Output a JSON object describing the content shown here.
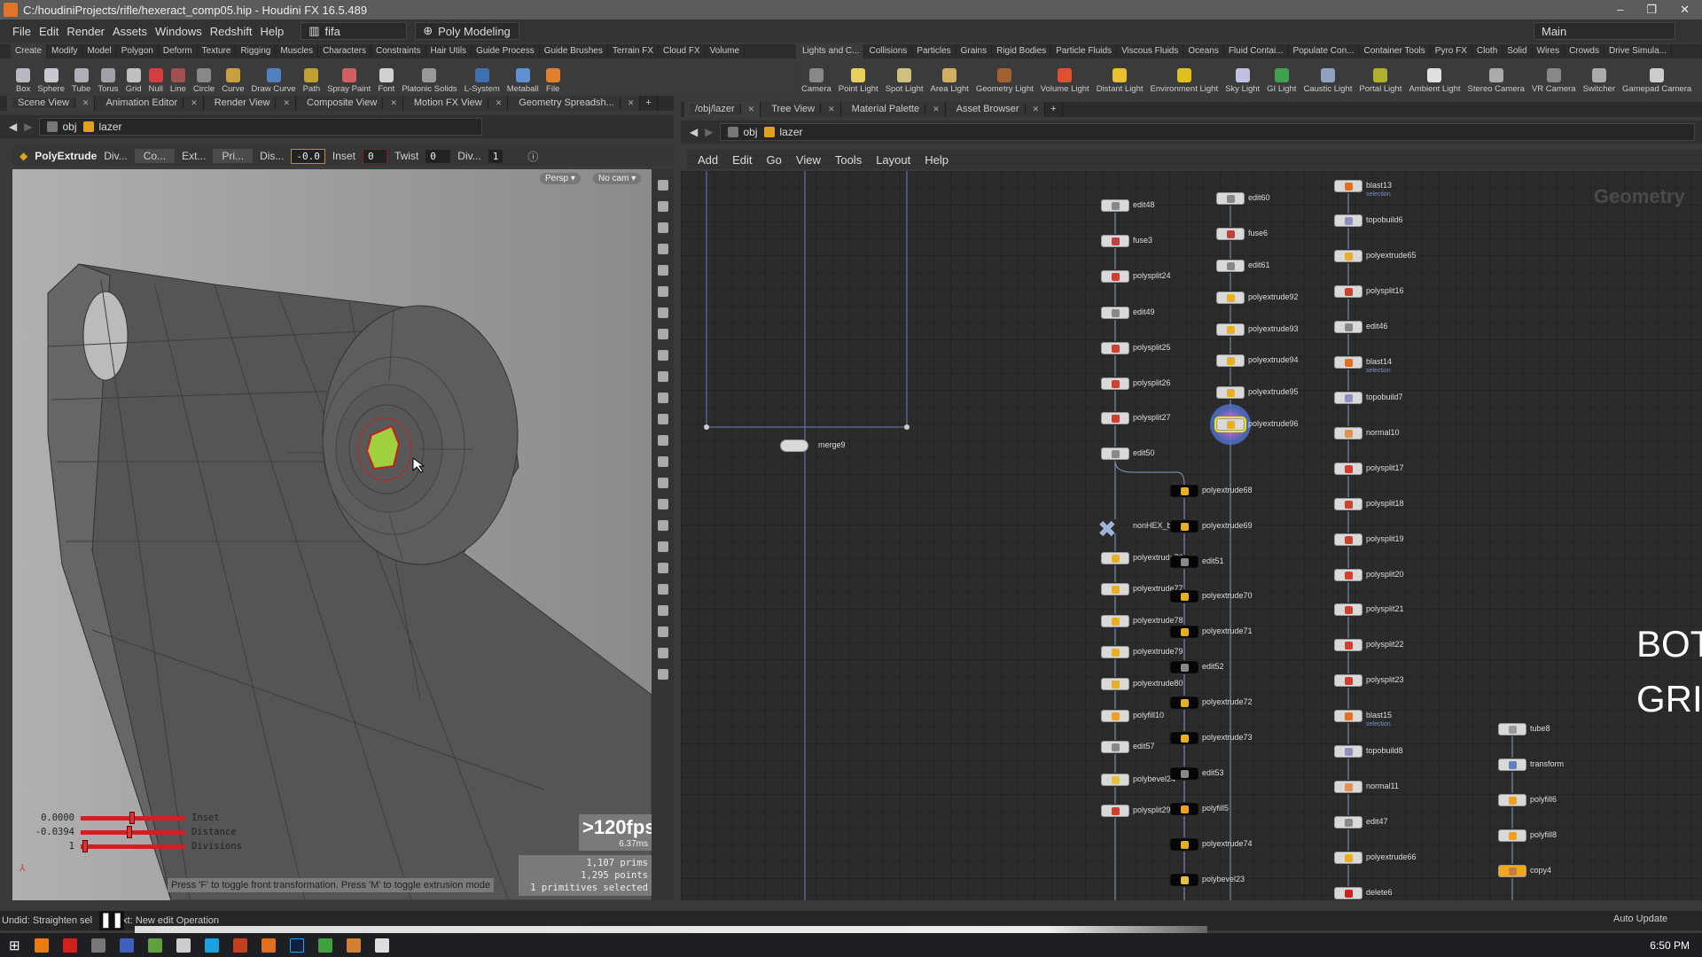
{
  "window": {
    "title": "C:/houdiniProjects/rifle/hexeract_comp05.hip - Houdini FX 16.5.489",
    "controls": [
      "–",
      "❐",
      "✕"
    ]
  },
  "menu": [
    "File",
    "Edit",
    "Render",
    "Assets",
    "Windows",
    "Redshift",
    "Help"
  ],
  "desktop": {
    "name": "fifa",
    "shelf_set": "Poly Modeling",
    "main": "Main"
  },
  "shelf_left": {
    "tabs": [
      "Create",
      "Modify",
      "Model",
      "Polygon",
      "Deform",
      "Texture",
      "Rigging",
      "Muscles",
      "Characters",
      "Constraints",
      "Hair Utils",
      "Guide Process",
      "Guide Brushes",
      "Terrain FX",
      "Cloud FX",
      "Volume"
    ],
    "tools": [
      {
        "label": "Box",
        "color": "#b8b8c0"
      },
      {
        "label": "Sphere",
        "color": "#c8c8d0"
      },
      {
        "label": "Tube",
        "color": "#b0b0b8"
      },
      {
        "label": "Torus",
        "color": "#a0a0a8"
      },
      {
        "label": "Grid",
        "color": "#c0c0c0"
      },
      {
        "label": "Null",
        "color": "#d04040"
      },
      {
        "label": "Line",
        "color": "#a05050"
      },
      {
        "label": "Circle",
        "color": "#888"
      },
      {
        "label": "Curve",
        "color": "#c8a040"
      },
      {
        "label": "Draw Curve",
        "color": "#5080c0"
      },
      {
        "label": "Path",
        "color": "#c0a030"
      },
      {
        "label": "Spray Paint",
        "color": "#d06060"
      },
      {
        "label": "Font",
        "color": "#d0d0d0"
      },
      {
        "label": "Platonic Solids",
        "color": "#999"
      },
      {
        "label": "L-System",
        "color": "#4070b0"
      },
      {
        "label": "Metaball",
        "color": "#6090d0"
      },
      {
        "label": "File",
        "color": "#e08030"
      }
    ]
  },
  "shelf_right": {
    "tabs": [
      "Lights and C...",
      "Collisions",
      "Particles",
      "Grains",
      "Rigid Bodies",
      "Particle Fluids",
      "Viscous Fluids",
      "Oceans",
      "Fluid Contai...",
      "Populate Con...",
      "Container Tools",
      "Pyro FX",
      "Cloth",
      "Solid",
      "Wires",
      "Crowds",
      "Drive Simula..."
    ],
    "tools": [
      {
        "label": "Camera",
        "color": "#888"
      },
      {
        "label": "Point Light",
        "color": "#e8d060"
      },
      {
        "label": "Spot Light",
        "color": "#d0c080"
      },
      {
        "label": "Area Light",
        "color": "#d0b060"
      },
      {
        "label": "Geometry Light",
        "color": "#a06030"
      },
      {
        "label": "Volume Light",
        "color": "#e05030"
      },
      {
        "label": "Distant Light",
        "color": "#e8c030"
      },
      {
        "label": "Environment Light",
        "color": "#e0c020"
      },
      {
        "label": "Sky Light",
        "color": "#c0c0e0"
      },
      {
        "label": "GI Light",
        "color": "#40a050"
      },
      {
        "label": "Caustic Light",
        "color": "#90a0c0"
      },
      {
        "label": "Portal Light",
        "color": "#b0b030"
      },
      {
        "label": "Ambient Light",
        "color": "#e0e0e0"
      },
      {
        "label": "Stereo Camera",
        "color": "#aaa"
      },
      {
        "label": "VR Camera",
        "color": "#888"
      },
      {
        "label": "Switcher",
        "color": "#aaa"
      },
      {
        "label": "Gamepad Camera",
        "color": "#ccc"
      }
    ]
  },
  "left_pane": {
    "tabs": [
      "Scene View",
      "Animation Editor",
      "Render View",
      "Composite View",
      "Motion FX View",
      "Geometry Spreadsh..."
    ],
    "path": [
      "obj",
      "lazer"
    ],
    "operation": {
      "name": "PolyExtrude",
      "div_label": "Div...",
      "co": "Co...",
      "ext": "Ext...",
      "pri": "Pri...",
      "dis_label": "Dis...",
      "dis_value": "-0.0",
      "inset_label": "Inset",
      "inset_value": "0",
      "twist_label": "Twist",
      "twist_value": "0",
      "div2_label": "Div...",
      "div2_value": "1"
    },
    "view": {
      "camera_menu": "Persp ▾",
      "cam": "No cam ▾"
    },
    "handles": [
      {
        "value": "0.0000",
        "label": "Inset",
        "fraction": 0.5
      },
      {
        "value": "-0.0394",
        "label": "Distance",
        "fraction": 0.47
      },
      {
        "value": "1",
        "label": "Divisions",
        "fraction": 0.02
      }
    ],
    "hint": "Press 'F' to toggle front transformation. Press 'M' to toggle extrusion mode",
    "stats": {
      "fps": ">120fps",
      "ms": "6.37ms",
      "prims": "1,107  prims",
      "points": "1,295 points",
      "selected": "1 primitives selected"
    }
  },
  "network": {
    "tabs": [
      "/obj/lazer",
      "Tree View",
      "Material Palette",
      "Asset Browser"
    ],
    "path": [
      "obj",
      "lazer"
    ],
    "menu": [
      "Add",
      "Edit",
      "Go",
      "View",
      "Tools",
      "Layout",
      "Help"
    ],
    "context_label": "Geometry",
    "sticky": [
      "BOT",
      "GRI"
    ],
    "merge": "merge9",
    "columns": [
      {
        "style": "light",
        "nodes": [
          "edit48",
          "fuse3",
          "polysplit24",
          "edit49",
          "polysplit25",
          "polysplit26",
          "polysplit27",
          "edit50",
          "nonHEX_back",
          "polyextrude76",
          "polyextrude77",
          "polyextrude78",
          "polyextrude79",
          "polyextrude80",
          "polyfill10",
          "edit57",
          "polybevel24",
          "polysplit29"
        ]
      },
      {
        "style": "dark",
        "nodes": [
          "polyextrude68",
          "polyextrude69",
          "edit51",
          "polyextrude70",
          "polyextrude71",
          "edit52",
          "polyextrude72",
          "polyextrude73",
          "edit53",
          "polyfill5",
          "polyextrude74",
          "polybevel23"
        ]
      },
      {
        "style": "light",
        "nodes": [
          "edit60",
          "fuse6",
          "edit61",
          "polyextrude92",
          "polyextrude93",
          "polyextrude94",
          "polyextrude95",
          "polyextrude96"
        ],
        "selected": "polyextrude96"
      },
      {
        "style": "light",
        "nodes": [
          "blast13",
          "topobuild6",
          "polyextrude65",
          "polysplit16",
          "edit46",
          "blast14",
          "topobuild7",
          "normal10",
          "polysplit17",
          "polysplit18",
          "polysplit19",
          "polysplit20",
          "polysplit21",
          "polysplit22",
          "polysplit23",
          "blast15",
          "topobuild8",
          "normal11",
          "edit47",
          "polyextrude66",
          "delete6"
        ],
        "subs": {
          "blast13": "selection",
          "blast14": "selection",
          "blast15": "selection"
        }
      },
      {
        "style": "light",
        "nodes": [
          "tube8",
          "transform",
          "polyfill6",
          "polyfill8",
          "copy4"
        ],
        "highlight": "copy4"
      }
    ]
  },
  "status": {
    "undo": "Undid: Straighten sel",
    "next": "Next: New edit Operation",
    "auto_update": "Auto Update"
  },
  "taskbar": {
    "clock": "6:50 PM"
  },
  "colors": {
    "accent": "#f3a81c",
    "selection": "#f3e600",
    "handle": "#cc2020"
  }
}
